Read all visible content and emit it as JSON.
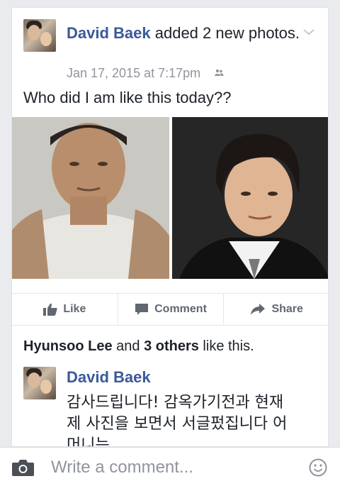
{
  "post": {
    "author": "David  Baek",
    "action_text": " added 2 new photos.",
    "timestamp": "Jan 17, 2015 at 7:17pm",
    "status": "Who did I am like this today??",
    "audience_icon": "friends-icon",
    "menu_icon": "chevron-down-icon"
  },
  "actions": {
    "like": "Like",
    "comment": "Comment",
    "share": "Share"
  },
  "likes": {
    "name": "Hyunsoo Lee",
    "middle": " and ",
    "others": "3 others",
    "suffix": " like this."
  },
  "comment": {
    "author": "David  Baek",
    "text": "감사드립니다! 감옥가기전과 현재 제 사진을 보면서 서글펐집니다 어머니는"
  },
  "composer": {
    "placeholder": "Write a comment..."
  },
  "colors": {
    "link": "#3b5998",
    "meta": "#90949c",
    "action": "#616770"
  }
}
